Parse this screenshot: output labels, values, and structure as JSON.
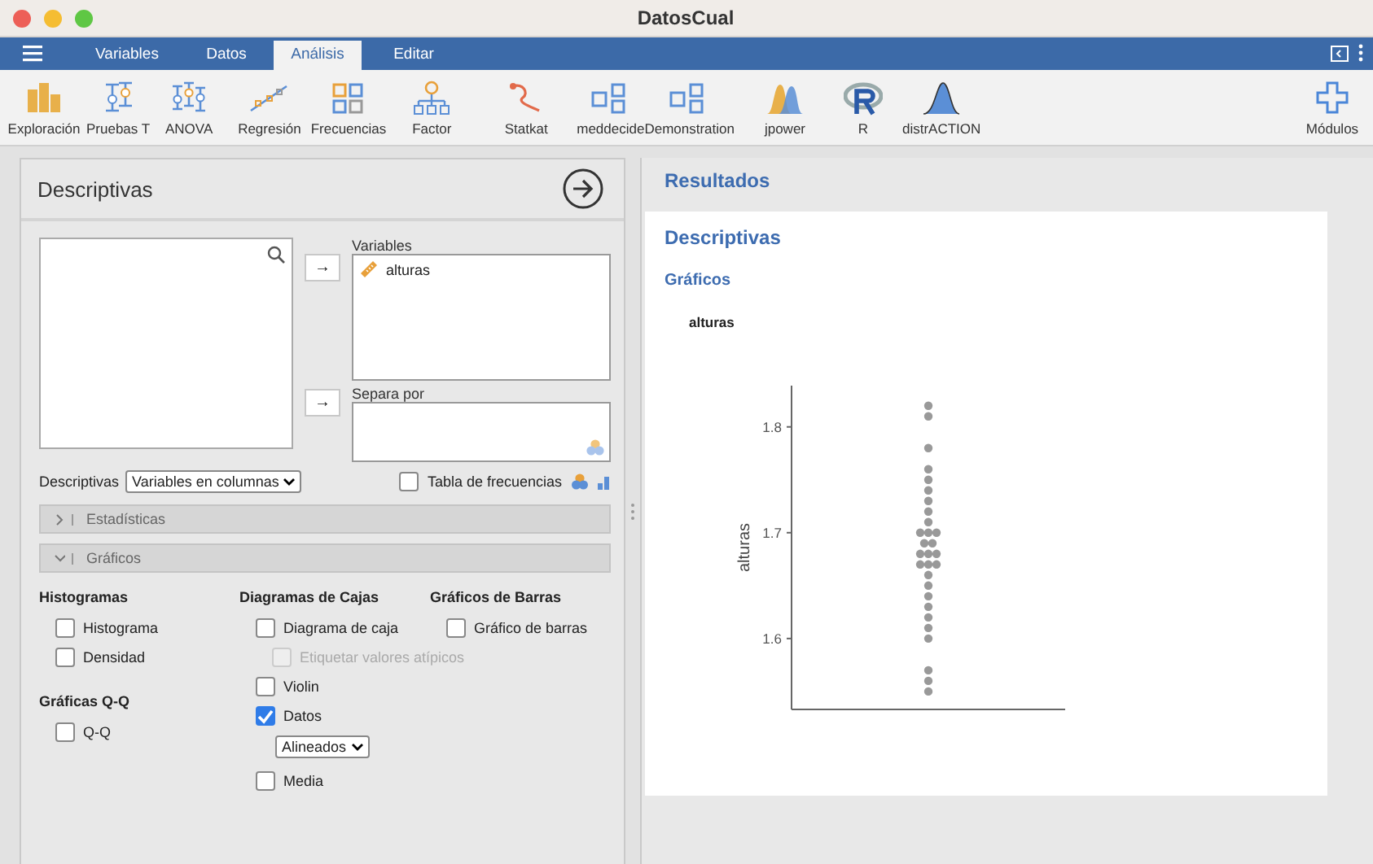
{
  "window": {
    "title": "DatosCual"
  },
  "menu_tabs": [
    {
      "label": "Variables",
      "selected": false
    },
    {
      "label": "Datos",
      "selected": false
    },
    {
      "label": "Análisis",
      "selected": true
    },
    {
      "label": "Editar",
      "selected": false
    }
  ],
  "toolbar": {
    "items": [
      {
        "label": "Exploración"
      },
      {
        "label": "Pruebas T"
      },
      {
        "label": "ANOVA"
      },
      {
        "label": "Regresión"
      },
      {
        "label": "Frecuencias"
      },
      {
        "label": "Factor"
      },
      {
        "label": "Statkat"
      },
      {
        "label": "meddecide"
      },
      {
        "label": "Demonstration"
      },
      {
        "label": "jpower"
      },
      {
        "label": "R"
      },
      {
        "label": "distrACTION"
      }
    ],
    "modules": "Módulos"
  },
  "analysis": {
    "title": "Descriptivas",
    "arrow_buttons": [
      "→",
      "→"
    ],
    "variables_label": "Variables",
    "variables": [
      {
        "name": "alturas"
      }
    ],
    "split_label": "Separa por",
    "descriptives_label": "Descriptivas",
    "descriptives_select": "Variables en columnas",
    "frequency_table": {
      "label": "Tabla de frecuencias",
      "checked": false
    },
    "sections": [
      {
        "label": "Estadísticas",
        "expanded": false
      },
      {
        "label": "Gráficos",
        "expanded": true
      }
    ],
    "plot_columns": [
      {
        "groups": [
          {
            "title": "Histogramas",
            "options": [
              {
                "kind": "checkbox",
                "label": "Histograma",
                "checked": false,
                "disabled": false
              },
              {
                "kind": "checkbox",
                "label": "Densidad",
                "checked": false,
                "disabled": false
              }
            ]
          },
          {
            "title": "Gráficas Q-Q",
            "options": [
              {
                "kind": "checkbox",
                "label": "Q-Q",
                "checked": false,
                "disabled": false
              }
            ]
          }
        ]
      },
      {
        "groups": [
          {
            "title": "Diagramas de Cajas",
            "options": [
              {
                "kind": "checkbox",
                "label": "Diagrama de caja",
                "checked": false,
                "disabled": false,
                "children": [
                  {
                    "kind": "checkbox",
                    "label": "Etiquetar valores atípicos",
                    "checked": false,
                    "disabled": true
                  }
                ]
              },
              {
                "kind": "checkbox",
                "label": "Violin",
                "checked": false,
                "disabled": false
              },
              {
                "kind": "checkbox",
                "label": "Datos",
                "checked": true,
                "disabled": false,
                "children": [
                  {
                    "kind": "select",
                    "label": "Alineados"
                  }
                ]
              },
              {
                "kind": "checkbox",
                "label": "Media",
                "checked": false,
                "disabled": false
              }
            ]
          }
        ]
      },
      {
        "groups": [
          {
            "title": "Gráficos de Barras",
            "options": [
              {
                "kind": "checkbox",
                "label": "Gráfico de barras",
                "checked": false,
                "disabled": false
              }
            ]
          }
        ]
      }
    ]
  },
  "results": {
    "title": "Resultados",
    "heading": "Descriptivas",
    "subheading": "Gráficos",
    "plot": {
      "title": "alturas",
      "ylabel": "alturas",
      "yticks": [
        "1.8",
        "1.7",
        "1.6"
      ]
    }
  }
}
